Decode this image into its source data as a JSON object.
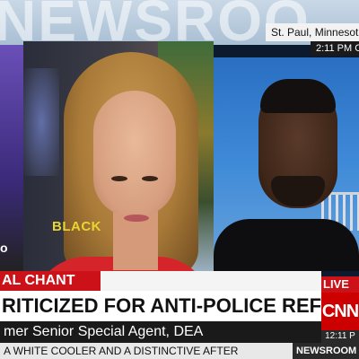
{
  "broadcast": {
    "backdrop_text": "NEWSROO",
    "location": "St. Paul, Minnesota",
    "time_top": "2:11 PM C",
    "segment_tag": "AL CHANT",
    "live_tag": "LIVE",
    "headline": "RITICIZED FOR ANTI-POLICE REFRAIN",
    "subhead": "mer Senior Special Agent, DEA",
    "network_logo": "CNN",
    "time_bottom": "12:11 P",
    "ticker_text": "A WHITE COOLER AND A DISTINCTIVE AFTER",
    "ticker_label": "NEWSROOM",
    "shirt_text": "BLACK",
    "left_panel_letter": "o"
  },
  "colors": {
    "accent_red": "#cc1118",
    "anchor_top": "#d6252a",
    "shirt_text": "#e8d530",
    "guest_bg": "#2a6fc2"
  }
}
